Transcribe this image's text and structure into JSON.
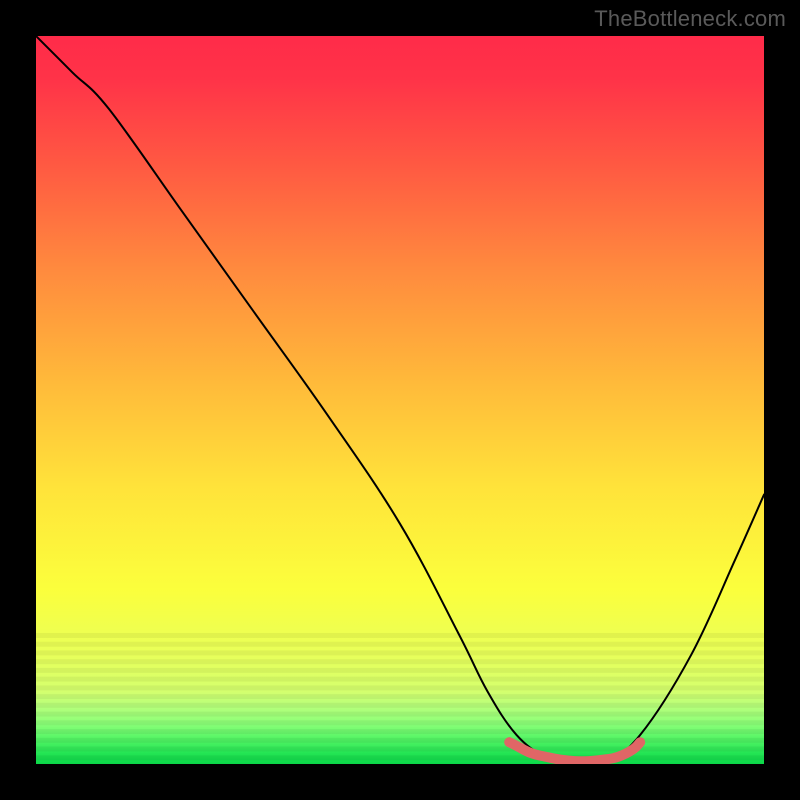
{
  "watermark": "TheBottleneck.com",
  "chart_data": {
    "type": "line",
    "title": "",
    "xlabel": "",
    "ylabel": "",
    "xlim": [
      0,
      100
    ],
    "ylim": [
      0,
      100
    ],
    "series": [
      {
        "name": "curve",
        "x": [
          0,
          5,
          10,
          20,
          30,
          40,
          50,
          58,
          62,
          66,
          70,
          74,
          78,
          83,
          90,
          96,
          100
        ],
        "y": [
          100,
          95,
          90,
          76,
          62,
          48,
          33,
          18,
          10,
          4,
          1,
          0,
          0,
          4,
          15,
          28,
          37
        ]
      },
      {
        "name": "marker",
        "x": [
          65,
          66,
          68,
          70,
          72,
          74,
          76,
          78,
          80,
          82,
          83
        ],
        "y": [
          3,
          2.5,
          1.5,
          1.0,
          0.6,
          0.4,
          0.4,
          0.6,
          1.0,
          2.0,
          3
        ]
      }
    ],
    "gradient_stops": [
      {
        "offset": 0.0,
        "color": "#ff2b49"
      },
      {
        "offset": 0.06,
        "color": "#ff3348"
      },
      {
        "offset": 0.18,
        "color": "#ff5a42"
      },
      {
        "offset": 0.32,
        "color": "#ff8a3e"
      },
      {
        "offset": 0.48,
        "color": "#ffbb3a"
      },
      {
        "offset": 0.62,
        "color": "#ffe33a"
      },
      {
        "offset": 0.76,
        "color": "#fbff3c"
      },
      {
        "offset": 0.85,
        "color": "#e8ff5a"
      },
      {
        "offset": 0.9,
        "color": "#d4ff6e"
      },
      {
        "offset": 0.92,
        "color": "#b8ff7a"
      },
      {
        "offset": 0.945,
        "color": "#8aff78"
      },
      {
        "offset": 0.965,
        "color": "#55f565"
      },
      {
        "offset": 0.985,
        "color": "#24e554"
      },
      {
        "offset": 1.0,
        "color": "#0bd848"
      }
    ],
    "green_band": {
      "y0": 0,
      "y1": 5
    },
    "marker_color": "#e06666",
    "curve_color": "#000000",
    "stripe_overlay": true
  }
}
